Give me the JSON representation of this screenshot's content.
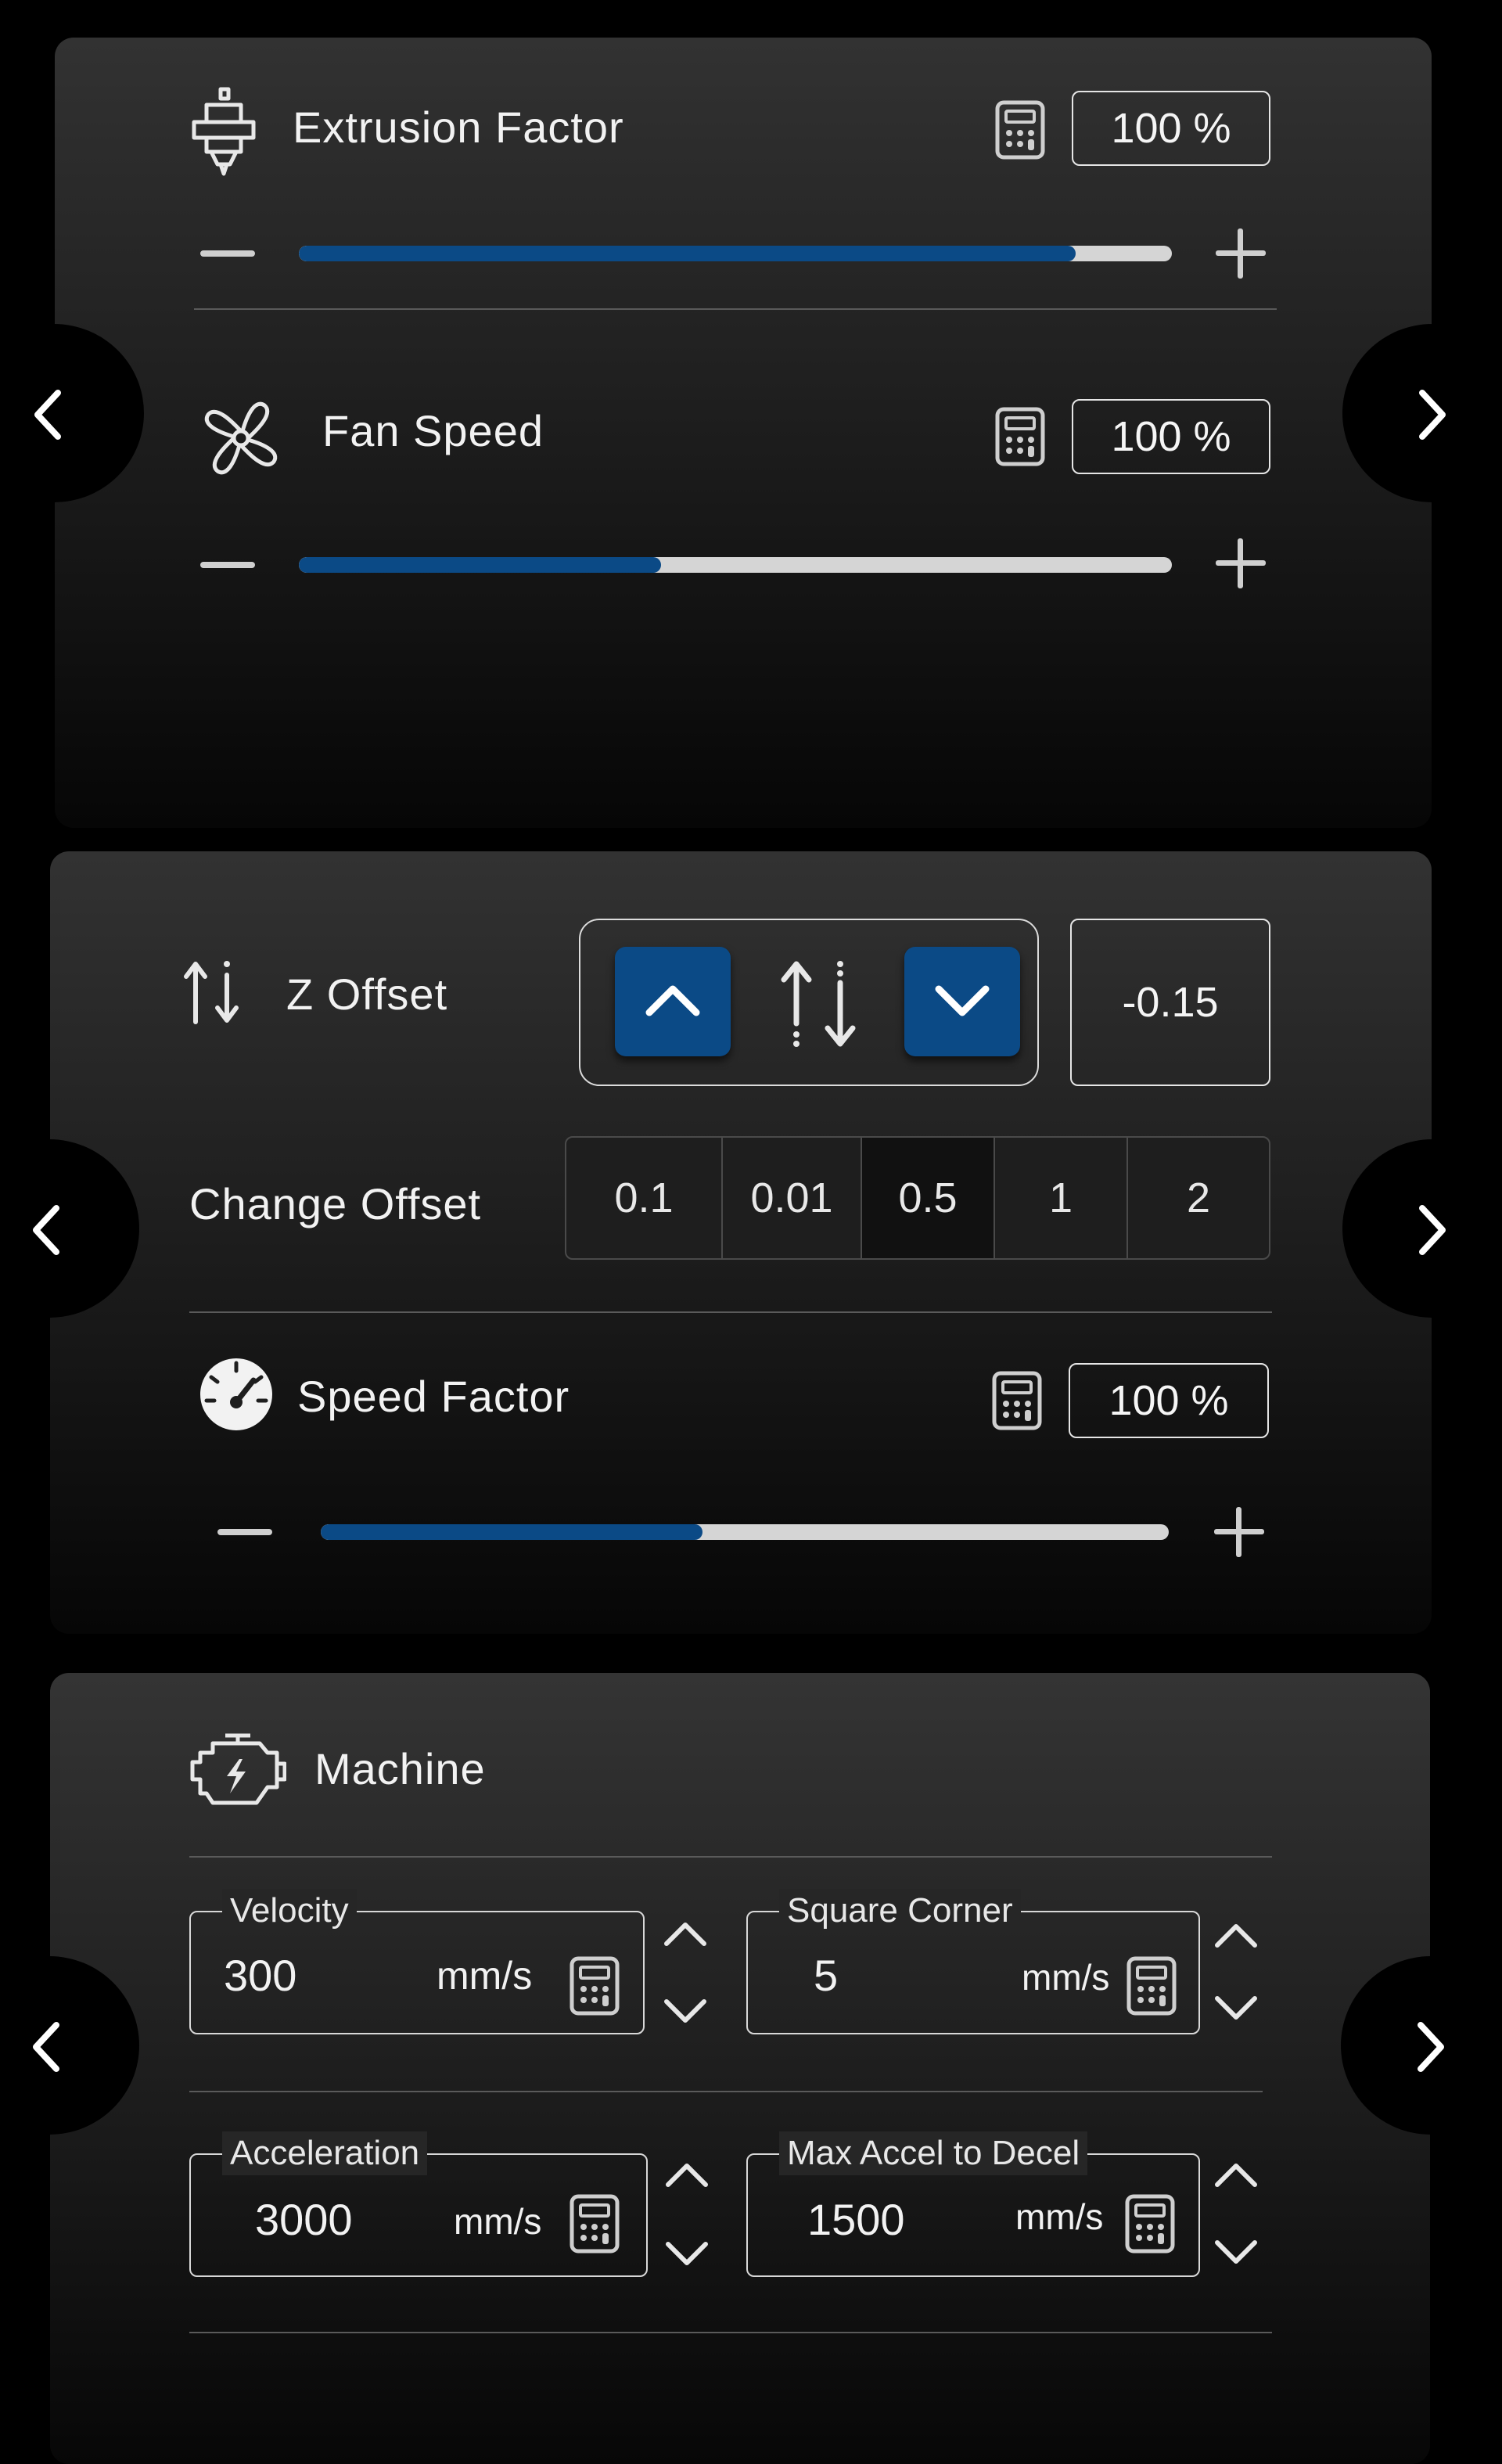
{
  "extrusion": {
    "title": "Extrusion Factor",
    "value": "100 %",
    "slider_fraction": 0.89
  },
  "fan": {
    "title": "Fan Speed",
    "value": "100 %",
    "slider_fraction": 0.415
  },
  "zoffset": {
    "title": "Z Offset",
    "value": "-0.15"
  },
  "change_offset": {
    "label": "Change Offset",
    "options": [
      "0.1",
      "0.01",
      "0.5",
      "1",
      "2"
    ],
    "selected": "0.5"
  },
  "speed": {
    "title": "Speed Factor",
    "value": "100 %",
    "slider_fraction": 0.45
  },
  "machine": {
    "title": "Machine",
    "velocity": {
      "label": "Velocity",
      "value": "300",
      "unit": "mm/s"
    },
    "square_corner": {
      "label": "Square Corner",
      "value": "5",
      "unit": "mm/s"
    },
    "acceleration": {
      "label": "Acceleration",
      "value": "3000",
      "unit": "mm/s"
    },
    "max_accel_to_decel": {
      "label": "Max Accel to Decel",
      "value": "1500",
      "unit": "mm/s"
    }
  },
  "accent_color": "#0b4a86"
}
